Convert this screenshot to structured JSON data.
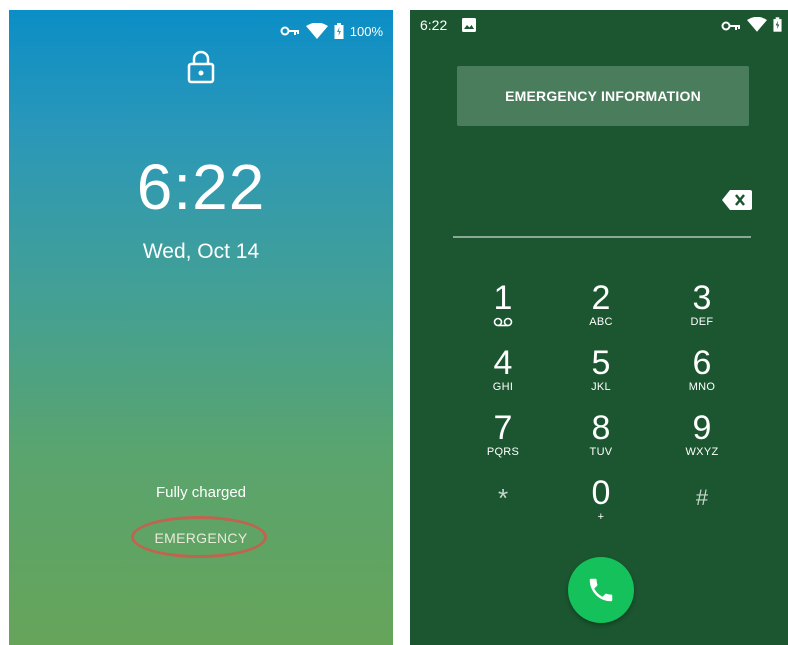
{
  "lock_screen": {
    "status": {
      "battery": "100%"
    },
    "time": "6:22",
    "date": "Wed, Oct 14",
    "charge_status": "Fully charged",
    "emergency_label": "EMERGENCY",
    "highlight_color": "#c0634f"
  },
  "dialer": {
    "status": {
      "time": "6:22"
    },
    "emergency_info_label": "EMERGENCY INFORMATION",
    "keys": [
      {
        "digit": "1",
        "letters": ""
      },
      {
        "digit": "2",
        "letters": "ABC"
      },
      {
        "digit": "3",
        "letters": "DEF"
      },
      {
        "digit": "4",
        "letters": "GHI"
      },
      {
        "digit": "5",
        "letters": "JKL"
      },
      {
        "digit": "6",
        "letters": "MNO"
      },
      {
        "digit": "7",
        "letters": "PQRS"
      },
      {
        "digit": "8",
        "letters": "TUV"
      },
      {
        "digit": "9",
        "letters": "WXYZ"
      },
      {
        "digit": "*",
        "letters": ""
      },
      {
        "digit": "0",
        "letters": "+"
      },
      {
        "digit": "#",
        "letters": ""
      }
    ],
    "colors": {
      "background": "#1b5630",
      "call_button": "#15c15b"
    }
  }
}
